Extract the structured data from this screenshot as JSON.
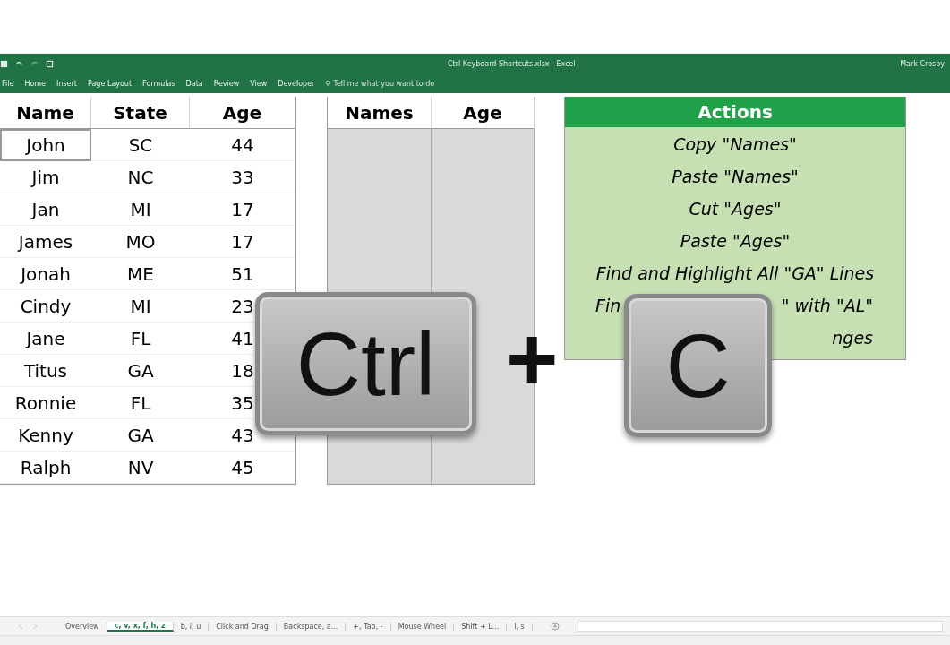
{
  "window": {
    "title": "Ctrl Keyboard Shortcuts.xlsx - Excel",
    "user": "Mark Crosby"
  },
  "ribbon_tabs": [
    {
      "label": "File",
      "selected": false
    },
    {
      "label": "Home",
      "selected": false
    },
    {
      "label": "Insert",
      "selected": false
    },
    {
      "label": "Page Layout",
      "selected": false
    },
    {
      "label": "Formulas",
      "selected": false
    },
    {
      "label": "Data",
      "selected": false
    },
    {
      "label": "Review",
      "selected": false
    },
    {
      "label": "View",
      "selected": false
    },
    {
      "label": "Developer",
      "selected": false
    }
  ],
  "tell_me": {
    "placeholder": "Tell me what you want to do"
  },
  "people_table": {
    "columns": [
      "Name",
      "State",
      "Age"
    ],
    "rows": [
      {
        "cells": [
          "John",
          "SC",
          "44"
        ],
        "selected": true
      },
      {
        "cells": [
          "Jim",
          "NC",
          "33"
        ],
        "selected": false
      },
      {
        "cells": [
          "Jan",
          "MI",
          "17"
        ],
        "selected": false
      },
      {
        "cells": [
          "James",
          "MO",
          "17"
        ],
        "selected": false
      },
      {
        "cells": [
          "Jonah",
          "ME",
          "51"
        ],
        "selected": false
      },
      {
        "cells": [
          "Cindy",
          "MI",
          "23"
        ],
        "selected": false
      },
      {
        "cells": [
          "Jane",
          "FL",
          "41"
        ],
        "selected": false
      },
      {
        "cells": [
          "Titus",
          "GA",
          "18"
        ],
        "selected": false
      },
      {
        "cells": [
          "Ronnie",
          "FL",
          "35"
        ],
        "selected": false
      },
      {
        "cells": [
          "Kenny",
          "GA",
          "43"
        ],
        "selected": false
      },
      {
        "cells": [
          "Ralph",
          "NV",
          "45"
        ],
        "selected": false
      }
    ]
  },
  "paste_table": {
    "columns": [
      "Names",
      "Age"
    ]
  },
  "actions": {
    "title": "Actions",
    "items": [
      {
        "text": "Copy \"Names\""
      },
      {
        "text": "Paste \"Names\""
      },
      {
        "text": "Cut \"Ages\""
      },
      {
        "text": "Paste \"Ages\""
      },
      {
        "text": "Find and Highlight All \"GA\" Lines"
      },
      {
        "left": "Fin",
        "right": "\" with \"AL\""
      },
      {
        "right": "nges"
      }
    ]
  },
  "shortcut": {
    "keys": [
      "Ctrl",
      "C"
    ],
    "joiner": "+"
  },
  "sheet_tabs": [
    {
      "label": "Overview",
      "selected": false
    },
    {
      "label": "c, v, x, f, h, z",
      "selected": true
    },
    {
      "label": "b, i, u",
      "selected": false
    },
    {
      "label": "Click and Drag",
      "selected": false
    },
    {
      "label": "Backspace, a...",
      "selected": false
    },
    {
      "label": "+, Tab, -",
      "selected": false
    },
    {
      "label": "Mouse Wheel",
      "selected": false
    },
    {
      "label": "Shift + L...",
      "selected": false
    },
    {
      "label": "l, s",
      "selected": false
    }
  ]
}
